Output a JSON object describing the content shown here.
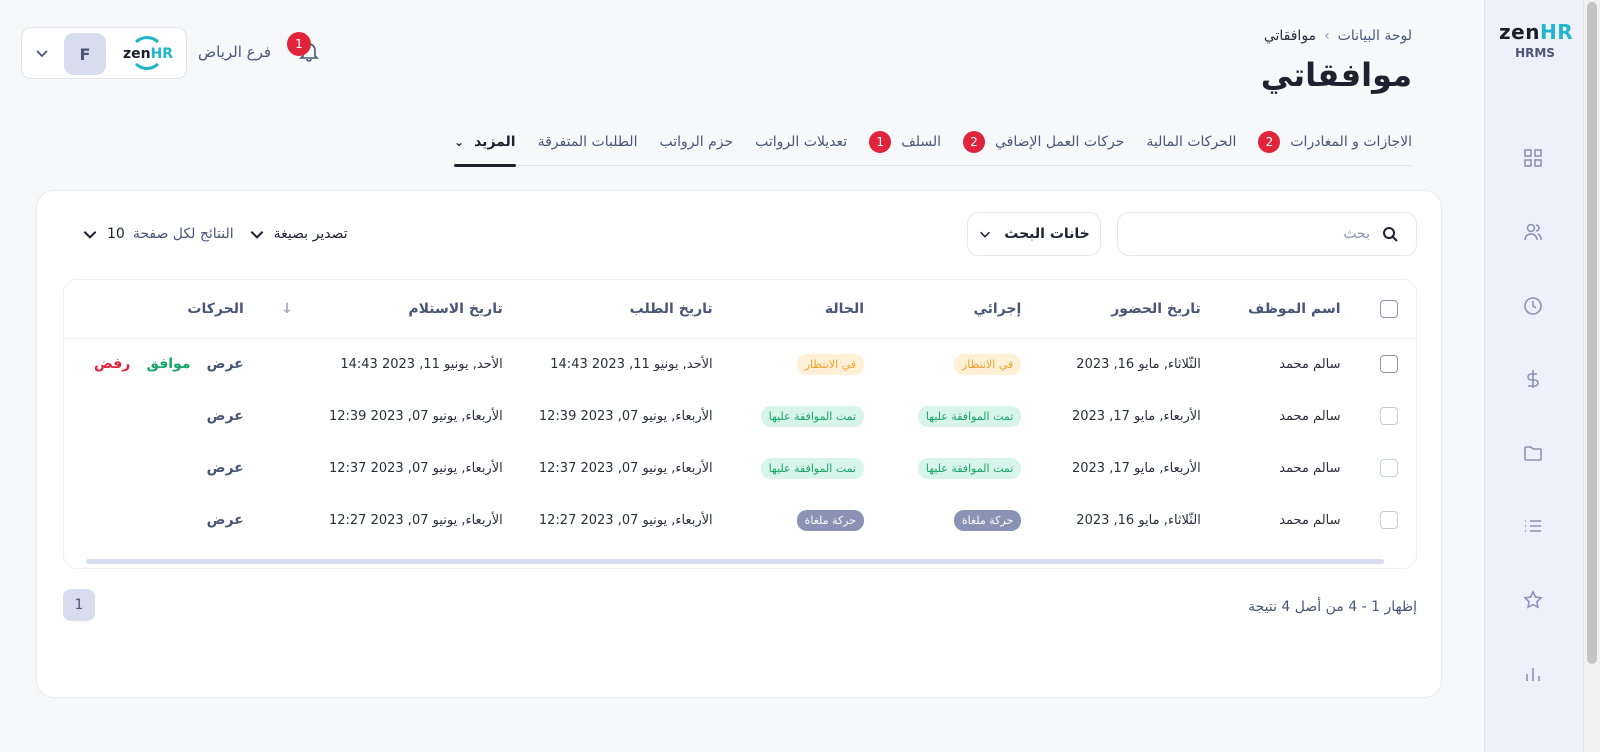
{
  "brand": {
    "logo_text": "zen",
    "logo_accent": "HR",
    "subtitle": "HRMS",
    "accent_color": "#1fb6c9"
  },
  "breadcrumb": {
    "home": "لوحة البيانات",
    "separator": "›",
    "current": "موافقاتي"
  },
  "page_title": "موافقاتي",
  "user": {
    "initial": "F",
    "branch": "فرع الرياض",
    "notification_count": "1"
  },
  "tabs": [
    {
      "label": "الاجازات و المغادرات",
      "badge": "2"
    },
    {
      "label": "الحركات المالية",
      "badge": ""
    },
    {
      "label": "حركات العمل الإضافي",
      "badge": "2"
    },
    {
      "label": "السلف",
      "badge": "1"
    },
    {
      "label": "تعديلات الرواتب",
      "badge": ""
    },
    {
      "label": "حزم الرواتب",
      "badge": ""
    },
    {
      "label": "الطلبات المتفرقة",
      "badge": ""
    },
    {
      "label": "المزيد",
      "badge": ""
    }
  ],
  "toolbar": {
    "search_placeholder": "بحث",
    "search_fields": "خانات البحث",
    "export_label": "تصدير بصيغة",
    "per_page_label": "النتائج لكل صفحة",
    "per_page_value": "10"
  },
  "table": {
    "headers": [
      "اسم الموظف",
      "تاريخ الحضور",
      "إجرائي",
      "الحالة",
      "تاريخ الطلب",
      "تاريخ الاستلام",
      "↓",
      "الحركات"
    ],
    "rows": [
      {
        "name": "سالم محمد",
        "attendance": "الثّلاثاء, مايو 16, 2023",
        "action_status": "في الانتظار",
        "action_kind": "pending",
        "status": "في الانتظار",
        "status_kind": "pending",
        "request_date": "الأحد, يونيو 11, 2023 14:43",
        "receive_date": "الأحد, يونيو 11, 2023 14:43",
        "view": "عرض",
        "approve": "موافق",
        "reject": "رفض"
      },
      {
        "name": "سالم محمد",
        "attendance": "الأربعاء, مايو 17, 2023",
        "action_status": "تمت الموافقة عليها",
        "action_kind": "approved",
        "status": "تمت الموافقة عليها",
        "status_kind": "approved",
        "request_date": "الأربعاء, يونيو 07, 2023 12:39",
        "receive_date": "الأربعاء, يونيو 07, 2023 12:39",
        "view": "عرض",
        "approve": "",
        "reject": ""
      },
      {
        "name": "سالم محمد",
        "attendance": "الأربعاء, مايو 17, 2023",
        "action_status": "تمت الموافقة عليها",
        "action_kind": "approved",
        "status": "تمت الموافقة عليها",
        "status_kind": "approved",
        "request_date": "الأربعاء, يونيو 07, 2023 12:37",
        "receive_date": "الأربعاء, يونيو 07, 2023 12:37",
        "view": "عرض",
        "approve": "",
        "reject": ""
      },
      {
        "name": "سالم محمد",
        "attendance": "الثّلاثاء, مايو 16, 2023",
        "action_status": "حركة ملغاة",
        "action_kind": "cancelled",
        "status": "حركة ملغاة",
        "status_kind": "cancelled",
        "request_date": "الأربعاء, يونيو 07, 2023 12:27",
        "receive_date": "الأربعاء, يونيو 07, 2023 12:27",
        "view": "عرض",
        "approve": "",
        "reject": ""
      }
    ]
  },
  "pagination": {
    "current_page": "1",
    "summary": "إظهار 1 - 4 من أصل 4 نتيجة"
  }
}
